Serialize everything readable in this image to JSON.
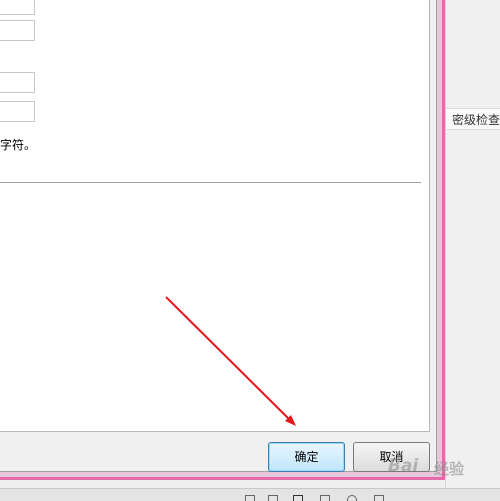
{
  "side_panel": {
    "tab_label": "密级检查"
  },
  "dialog": {
    "hint_text": "字符。",
    "ok_label": "确定",
    "cancel_label": "取消"
  },
  "watermark": {
    "brand": "Bai",
    "service": "经验"
  },
  "colors": {
    "frame_accent": "#e36ba9",
    "annotation_arrow": "#e8161b",
    "ok_button": "#bee6fd"
  },
  "icons": [
    "view-icon",
    "view-icon",
    "view-icon",
    "view-icon",
    "view-icon",
    "view-icon"
  ]
}
